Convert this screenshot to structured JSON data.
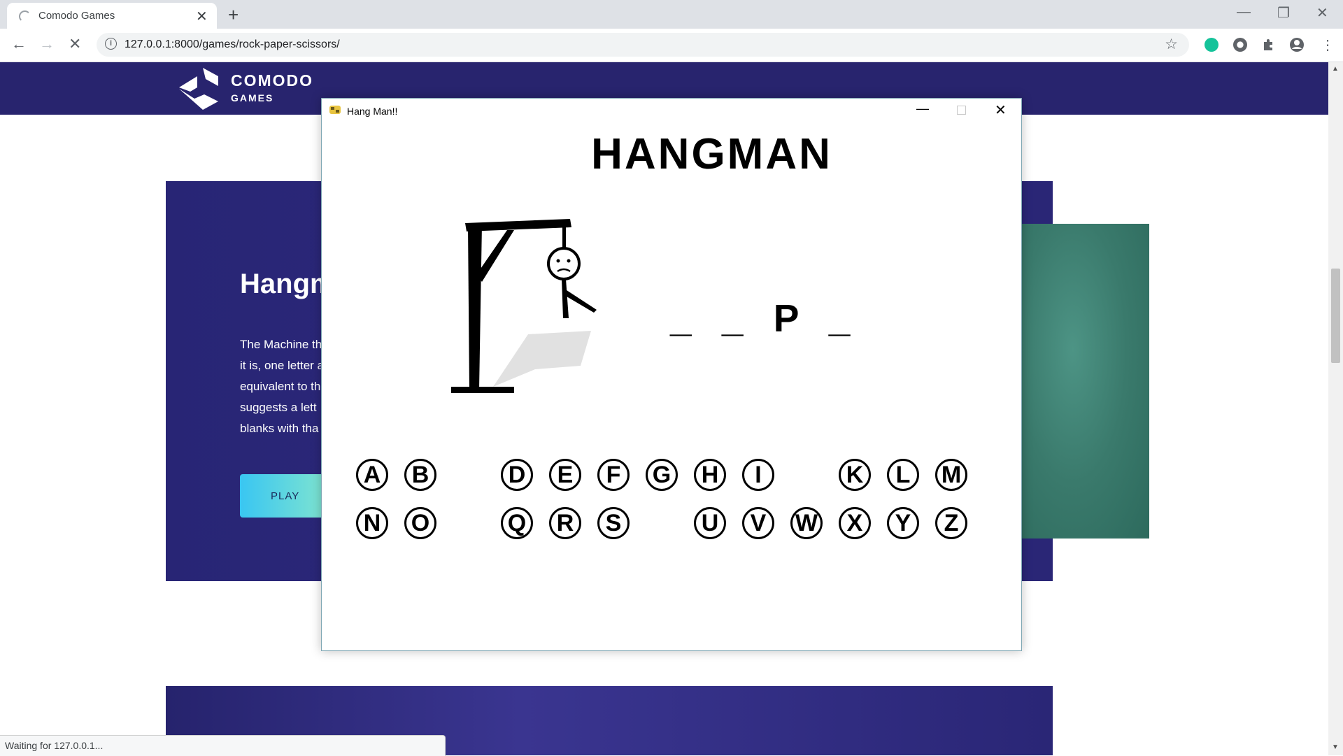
{
  "browser": {
    "tab_title": "Comodo Games",
    "url": "127.0.0.1:8000/games/rock-paper-scissors/",
    "status_text": "Waiting for 127.0.0.1..."
  },
  "site": {
    "logo_line1": "COMODO",
    "logo_line2": "GAMES",
    "card_title": "Hangm",
    "card_desc_lines": [
      "The Machine th",
      "it is, one letter a",
      "equivalent to th",
      "suggests a lett",
      "blanks with tha"
    ],
    "play_label": "PLAY"
  },
  "hangman": {
    "window_title": "Hang Man!!",
    "heading": "HANGMAN",
    "word_display": "_ _ P _",
    "letters_row1": [
      {
        "letter": "A",
        "col": 0
      },
      {
        "letter": "B",
        "col": 1
      },
      {
        "letter": "D",
        "col": 3
      },
      {
        "letter": "E",
        "col": 4
      },
      {
        "letter": "F",
        "col": 5
      },
      {
        "letter": "G",
        "col": 6
      },
      {
        "letter": "H",
        "col": 7
      },
      {
        "letter": "I",
        "col": 8
      },
      {
        "letter": "K",
        "col": 10
      },
      {
        "letter": "L",
        "col": 11
      },
      {
        "letter": "M",
        "col": 12
      }
    ],
    "letters_row2": [
      {
        "letter": "N",
        "col": 0
      },
      {
        "letter": "O",
        "col": 1
      },
      {
        "letter": "Q",
        "col": 3
      },
      {
        "letter": "R",
        "col": 4
      },
      {
        "letter": "S",
        "col": 5
      },
      {
        "letter": "U",
        "col": 7
      },
      {
        "letter": "V",
        "col": 8
      },
      {
        "letter": "W",
        "col": 9
      },
      {
        "letter": "X",
        "col": 10
      },
      {
        "letter": "Y",
        "col": 11
      },
      {
        "letter": "Z",
        "col": 12
      }
    ]
  }
}
